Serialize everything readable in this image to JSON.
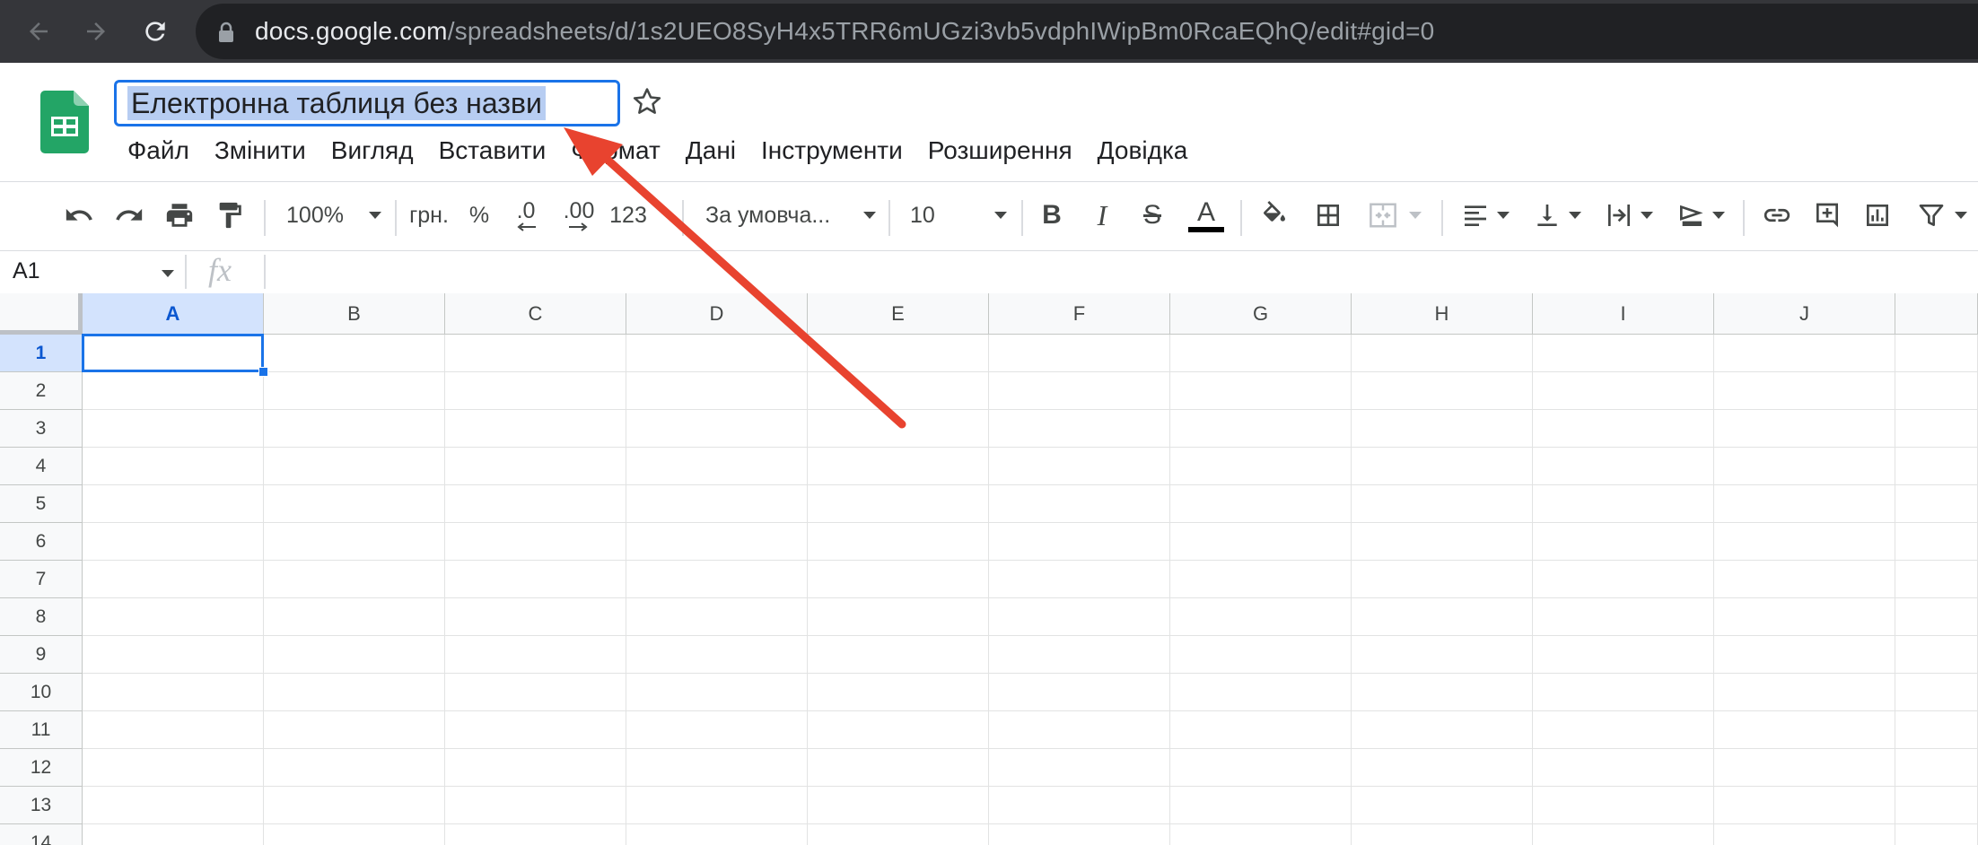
{
  "browser": {
    "url_host": "docs.google.com",
    "url_path": "/spreadsheets/d/1s2UEO8SyH4x5TRR6mUGzi3vb5vdphIWipBm0RcaEQhQ/edit#gid=0",
    "back_icon": "back-arrow-icon",
    "forward_icon": "forward-arrow-icon",
    "reload_icon": "reload-icon",
    "lock_icon": "lock-icon"
  },
  "document": {
    "title": "Електронна таблиця без назви",
    "star_icon": "star-outline-icon"
  },
  "menu": [
    {
      "label": "Файл"
    },
    {
      "label": "Змінити"
    },
    {
      "label": "Вигляд"
    },
    {
      "label": "Вставити"
    },
    {
      "label": "Формат"
    },
    {
      "label": "Дані"
    },
    {
      "label": "Інструменти"
    },
    {
      "label": "Розширення"
    },
    {
      "label": "Довідка"
    }
  ],
  "toolbar": {
    "zoom": "100%",
    "currency": "грн.",
    "percent": "%",
    "decrease_decimals": ".0",
    "increase_decimals": ".00",
    "more_formats": "123",
    "font": "За умовча...",
    "font_size": "10",
    "bold": "B",
    "italic": "I",
    "strike": "S",
    "text_color": "A"
  },
  "formula_bar": {
    "name_box": "A1",
    "fx": "fx"
  },
  "grid": {
    "columns": [
      "A",
      "B",
      "C",
      "D",
      "E",
      "F",
      "G",
      "H",
      "I",
      "J"
    ],
    "rows": [
      "1",
      "2",
      "3",
      "4",
      "5",
      "6",
      "7",
      "8",
      "9",
      "10",
      "11",
      "12",
      "13",
      "14"
    ],
    "selected_cell": "A1"
  },
  "annotation": {
    "arrow_color": "#e8432f"
  },
  "colors": {
    "accent": "#1a73e8",
    "title_highlight": "#b7cdf2",
    "sheets_green": "#23a566",
    "chrome_bar": "#35363a"
  }
}
